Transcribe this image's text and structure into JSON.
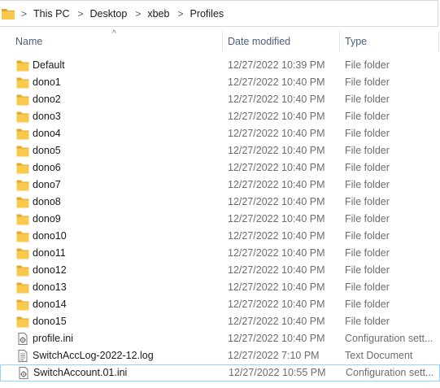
{
  "address_bar": {
    "separator": ">",
    "crumbs": [
      "This PC",
      "Desktop",
      "xbeb",
      "Profiles"
    ]
  },
  "columns": {
    "name": "Name",
    "date_modified": "Date modified",
    "type": "Type",
    "sort_indicator": "^"
  },
  "colors": {
    "folder": "#f8c94a",
    "folder_dark": "#e4a72b",
    "selection_border": "#99d1ff",
    "header_text": "#4c607a"
  },
  "files": [
    {
      "name": "Default",
      "date": "12/27/2022 10:39 PM",
      "type": "File folder",
      "icon": "folder-icon"
    },
    {
      "name": "dono1",
      "date": "12/27/2022 10:40 PM",
      "type": "File folder",
      "icon": "folder-icon"
    },
    {
      "name": "dono2",
      "date": "12/27/2022 10:40 PM",
      "type": "File folder",
      "icon": "folder-icon"
    },
    {
      "name": "dono3",
      "date": "12/27/2022 10:40 PM",
      "type": "File folder",
      "icon": "folder-icon"
    },
    {
      "name": "dono4",
      "date": "12/27/2022 10:40 PM",
      "type": "File folder",
      "icon": "folder-icon"
    },
    {
      "name": "dono5",
      "date": "12/27/2022 10:40 PM",
      "type": "File folder",
      "icon": "folder-icon"
    },
    {
      "name": "dono6",
      "date": "12/27/2022 10:40 PM",
      "type": "File folder",
      "icon": "folder-icon"
    },
    {
      "name": "dono7",
      "date": "12/27/2022 10:40 PM",
      "type": "File folder",
      "icon": "folder-icon"
    },
    {
      "name": "dono8",
      "date": "12/27/2022 10:40 PM",
      "type": "File folder",
      "icon": "folder-icon"
    },
    {
      "name": "dono9",
      "date": "12/27/2022 10:40 PM",
      "type": "File folder",
      "icon": "folder-icon"
    },
    {
      "name": "dono10",
      "date": "12/27/2022 10:40 PM",
      "type": "File folder",
      "icon": "folder-icon"
    },
    {
      "name": "dono11",
      "date": "12/27/2022 10:40 PM",
      "type": "File folder",
      "icon": "folder-icon"
    },
    {
      "name": "dono12",
      "date": "12/27/2022 10:40 PM",
      "type": "File folder",
      "icon": "folder-icon"
    },
    {
      "name": "dono13",
      "date": "12/27/2022 10:40 PM",
      "type": "File folder",
      "icon": "folder-icon"
    },
    {
      "name": "dono14",
      "date": "12/27/2022 10:40 PM",
      "type": "File folder",
      "icon": "folder-icon"
    },
    {
      "name": "dono15",
      "date": "12/27/2022 10:40 PM",
      "type": "File folder",
      "icon": "folder-icon"
    },
    {
      "name": "profile.ini",
      "date": "12/27/2022 10:40 PM",
      "type": "Configuration sett...",
      "icon": "settings-file-icon"
    },
    {
      "name": "SwitchAccLog-2022-12.log",
      "date": "12/27/2022 7:10 PM",
      "type": "Text Document",
      "icon": "text-file-icon"
    },
    {
      "name": "SwitchAccount.01.ini",
      "date": "12/27/2022 10:55 PM",
      "type": "Configuration sett...",
      "icon": "settings-file-icon",
      "selected": true
    }
  ]
}
